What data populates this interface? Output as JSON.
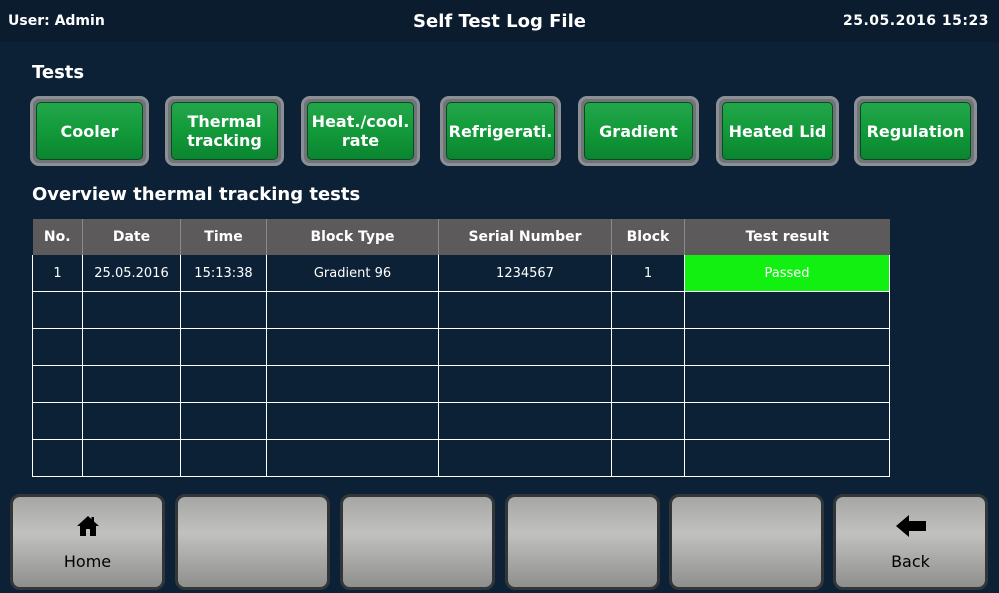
{
  "header": {
    "user": "User: Admin",
    "title": "Self Test Log File",
    "datetime": "25.05.2016  15:23"
  },
  "tests_section": {
    "title": "Tests"
  },
  "test_buttons": [
    "Cooler",
    "Thermal\ntracking",
    "Heat./cool.\nrate",
    "Refrigerati.",
    "Gradient",
    "Heated Lid",
    "Regulation"
  ],
  "overview": {
    "title": "Overview thermal tracking tests"
  },
  "table": {
    "columns": [
      "No.",
      "Date",
      "Time",
      "Block Type",
      "Serial Number",
      "Block",
      "Test result"
    ],
    "rows": [
      [
        "1",
        "25.05.2016",
        "15:13:38",
        "Gradient 96",
        "1234567",
        "1",
        "Passed"
      ],
      [
        "",
        "",
        "",
        "",
        "",
        "",
        ""
      ],
      [
        "",
        "",
        "",
        "",
        "",
        "",
        ""
      ],
      [
        "",
        "",
        "",
        "",
        "",
        "",
        ""
      ],
      [
        "",
        "",
        "",
        "",
        "",
        "",
        ""
      ],
      [
        "",
        "",
        "",
        "",
        "",
        "",
        ""
      ]
    ],
    "pass_color": "#11f011"
  },
  "nav": {
    "home": {
      "label": "Home",
      "icon": "home-icon"
    },
    "back": {
      "label": "Back",
      "icon": "arrow-left-icon"
    },
    "empty_count": 4
  },
  "colors": {
    "background": "#0d2136",
    "button_green": "#129a3a",
    "header_gray": "#5c5a5a"
  }
}
